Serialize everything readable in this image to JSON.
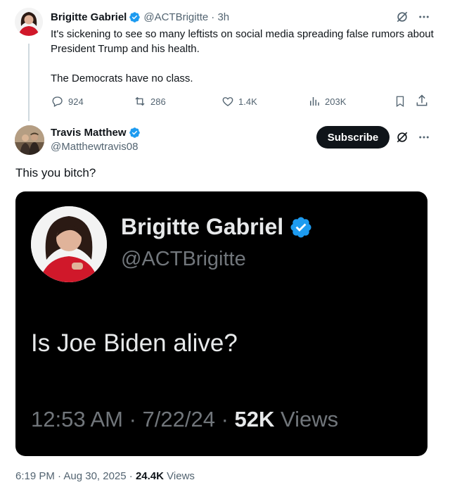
{
  "parent_tweet": {
    "name": "Brigitte Gabriel",
    "handle": "@ACTBrigitte",
    "time": "· 3h",
    "paragraph1": "It's sickening to see so many leftists on social media spreading false rumors about President Trump and his health.",
    "paragraph2": "The Democrats have no class.",
    "replies": "924",
    "reposts": "286",
    "likes": "1.4K",
    "views": "203K"
  },
  "reply_tweet": {
    "name": "Travis Matthew",
    "handle": "@Matthewtravis08",
    "subscribe_label": "Subscribe",
    "text": "This you bitch?",
    "timestamp": "6:19 PM · Aug 30, 2025 · ",
    "views_count": "24.4K",
    "views_label": "Views"
  },
  "embedded_screenshot": {
    "name": "Brigitte Gabriel",
    "handle": "@ACTBrigitte",
    "text": "Is Joe Biden alive?",
    "meta_time": "12:53 AM · 7/22/24 · ",
    "meta_views": "52K",
    "meta_views_label": "Views"
  },
  "colors": {
    "verified_blue": "#1d9bf0",
    "text_primary": "#0f1419",
    "text_secondary": "#536471"
  },
  "icons": [
    "verified-badge-icon",
    "grok-icon",
    "more-icon",
    "reply-icon",
    "repost-icon",
    "like-icon",
    "views-icon",
    "bookmark-icon",
    "share-icon"
  ]
}
